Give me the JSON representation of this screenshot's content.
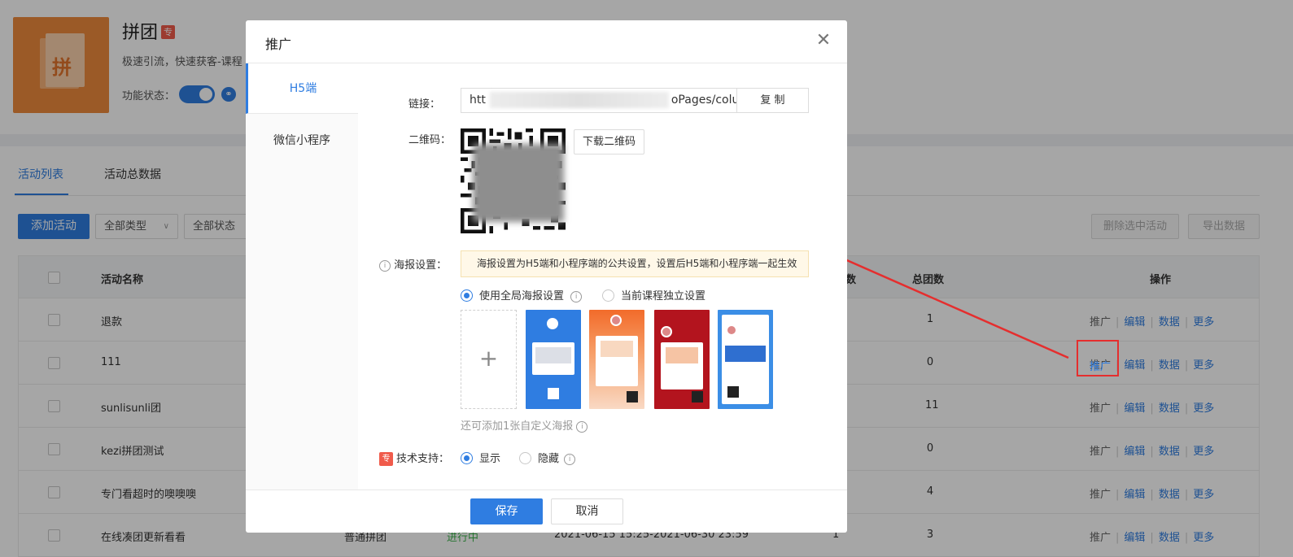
{
  "app": {
    "title": "拼团",
    "pro_badge": "专",
    "logo_glyph": "拼",
    "description": "极速引流，快速获客-课程",
    "status_label": "功能状态：",
    "link_icon": "link-icon"
  },
  "tabs": [
    {
      "label": "活动列表",
      "active": true
    },
    {
      "label": "活动总数据",
      "active": false
    }
  ],
  "toolbar": {
    "add_label": "添加活动",
    "type_filter": "全部类型",
    "status_filter": "全部状态",
    "delete_label": "删除选中活动",
    "export_label": "导出数据"
  },
  "table": {
    "headers": {
      "name": "活动名称",
      "count_tail": "数",
      "total_groups": "总团数",
      "ops": "操作"
    },
    "rows": [
      {
        "name": "退款",
        "total": "1"
      },
      {
        "name": "111",
        "total": "0"
      },
      {
        "name": "sunlisunli团",
        "total": "11"
      },
      {
        "name": "kezi拼团测试",
        "total": "0"
      },
      {
        "name": "专门看超时的噢噢噢",
        "total": "4"
      },
      {
        "name": "在线凑团更新看看",
        "type": "普通拼团",
        "status": "进行中",
        "time": "2021-06-15 15:25-2021-06-30 23:59",
        "count": "1",
        "total": "3"
      }
    ],
    "ops": [
      "推广",
      "编辑",
      "数据",
      "更多"
    ]
  },
  "modal": {
    "title": "推广",
    "close_icon": "close-icon",
    "side_tabs": [
      "H5端",
      "微信小程序"
    ],
    "link_label": "链接：",
    "link_value_start": "htt",
    "link_value_end": "oPages/colu",
    "copy_label": "复 制",
    "qr_label": "二维码：",
    "download_qr_label": "下载二维码",
    "poster_label": "海报设置：",
    "poster_notice": "海报设置为H5端和小程序端的公共设置，设置后H5端和小程序端一起生效",
    "poster_option_global": "使用全局海报设置",
    "poster_option_custom": "当前课程独立设置",
    "poster_hint": "还可添加1张自定义海报",
    "support_label": "技术支持：",
    "support_show": "显示",
    "support_hide": "隐藏",
    "save_label": "保存",
    "cancel_label": "取消"
  },
  "colors": {
    "primary": "#2f7de1",
    "highlight": "#e52e2e",
    "status_green": "#3bb34a",
    "badge": "#f05b4b"
  }
}
